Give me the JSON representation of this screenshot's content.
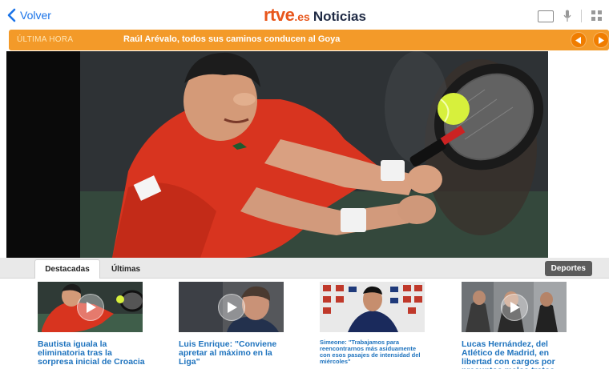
{
  "topbar": {
    "back_label": "Volver",
    "brand": "rtve",
    "brand_suffix": ".es",
    "section": "Noticias"
  },
  "ticker": {
    "label": "ÚLTIMA HORA",
    "headline": "Raúl Arévalo, todos sus caminos conducen al Goya"
  },
  "tabs": [
    {
      "label": "Destacadas",
      "active": true
    },
    {
      "label": "Últimas",
      "active": false
    }
  ],
  "section_button": "Deportes",
  "cards": [
    {
      "title": "Bautista iguala la eliminatoria tras la sorpresa inicial de Croacia"
    },
    {
      "title": "Luis Enrique: \"Conviene apretar al máximo en la Liga\""
    },
    {
      "title": "Simeone: \"Trabajamos para reencontrarnos más asiduamente con esos pasajes de intensidad del miércoles\""
    },
    {
      "title": "Lucas Hernández, del Atlético de Madrid, en libertad con cargos por presuntos malos tratos"
    }
  ],
  "colors": {
    "brand": "#e8561b",
    "ticker": "#f39a29",
    "link": "#1e73be"
  }
}
